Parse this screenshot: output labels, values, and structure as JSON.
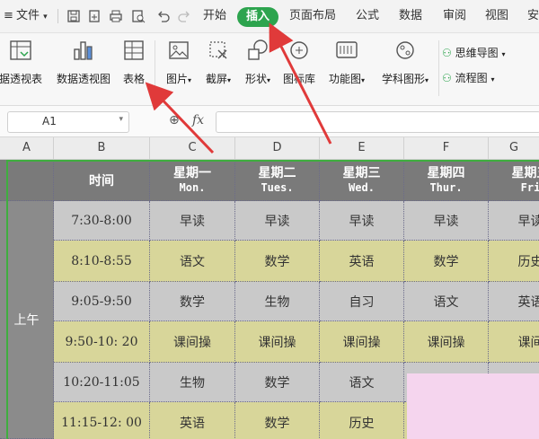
{
  "menubar": {
    "file_label": "文件",
    "tabs": [
      "开始",
      "插入",
      "页面布局",
      "公式",
      "数据",
      "审阅",
      "视图",
      "安"
    ]
  },
  "ribbon": {
    "buttons": [
      "据透视表",
      "数据透视图",
      "表格",
      "图片",
      "截屏",
      "形状",
      "图标库",
      "功能图",
      "学科图形"
    ],
    "small_buttons": [
      "思维导图",
      "流程图"
    ]
  },
  "formula_bar": {
    "name_box": "A1",
    "fx_label": "fx",
    "value": ""
  },
  "columns": [
    "A",
    "B",
    "C",
    "D",
    "E",
    "F",
    "G"
  ],
  "timetable": {
    "time_header": "时间",
    "days": [
      {
        "cn": "星期一",
        "en": "Mon."
      },
      {
        "cn": "星期二",
        "en": "Tues."
      },
      {
        "cn": "星期三",
        "en": "Wed."
      },
      {
        "cn": "星期四",
        "en": "Thur."
      },
      {
        "cn": "星期五",
        "en": "Fri"
      }
    ],
    "morning_label": "上午",
    "rows": [
      {
        "time": "7:30-8:00",
        "cells": [
          "早读",
          "早读",
          "早读",
          "早读",
          "早读"
        ]
      },
      {
        "time": "8:10-8:55",
        "cells": [
          "语文",
          "数学",
          "英语",
          "数学",
          "历史"
        ]
      },
      {
        "time": "9:05-9:50",
        "cells": [
          "数学",
          "生物",
          "自习",
          "语文",
          "英语"
        ]
      },
      {
        "time": "9:50-10: 20",
        "cells": [
          "课间操",
          "课间操",
          "课间操",
          "课间操",
          "课间"
        ]
      },
      {
        "time": "10:20-11:05",
        "cells": [
          "生物",
          "数学",
          "语文",
          "",
          ""
        ]
      },
      {
        "time": "11:15-12: 00",
        "cells": [
          "英语",
          "数学",
          "历史",
          "",
          ""
        ]
      }
    ]
  },
  "colors": {
    "insert_tab": "#2da44e",
    "header_bg": "#7a7a7a",
    "row_gray": "#c9c9c9",
    "row_yellow": "#d8d69a",
    "selection": "#3fae3f",
    "arrow": "#e03a3a"
  }
}
